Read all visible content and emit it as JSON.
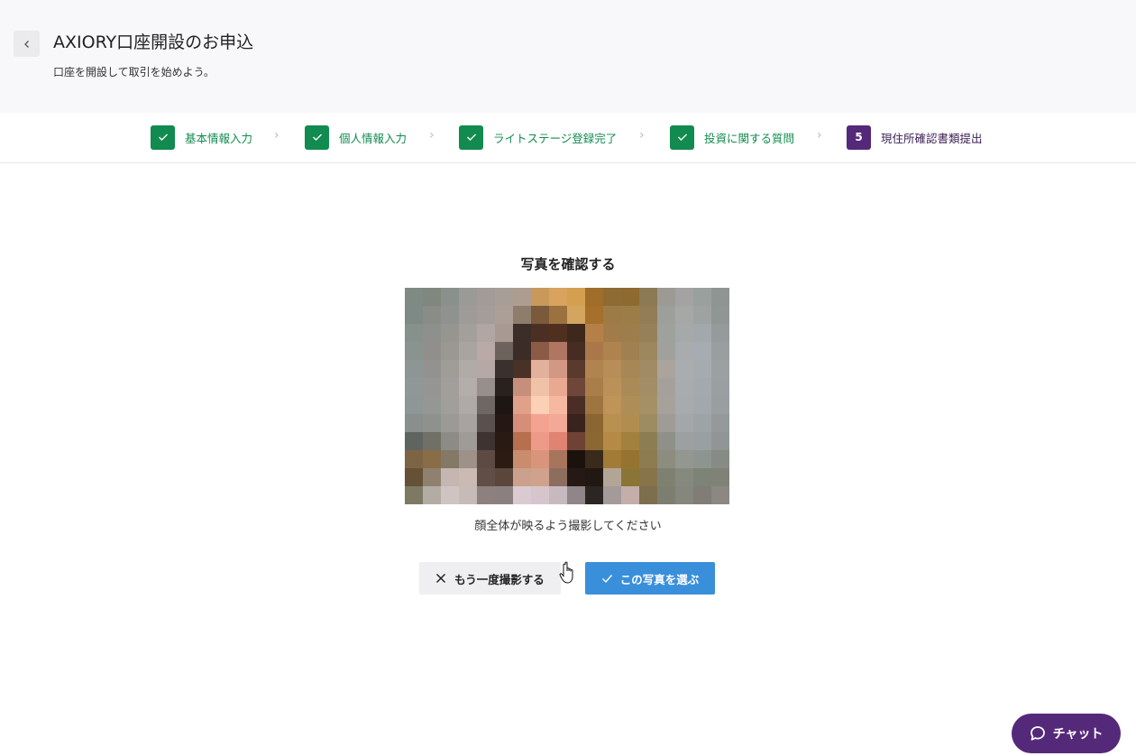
{
  "header": {
    "back_icon": "chevron-left-icon",
    "title": "AXIORY口座開設のお申込",
    "subtitle": "口座を開設して取引を始めよう。"
  },
  "stepper": {
    "steps": [
      {
        "label": "基本情報入力",
        "status": "done",
        "badge": "✓"
      },
      {
        "label": "個人情報入力",
        "status": "done",
        "badge": "✓"
      },
      {
        "label": "ライトステージ登録完了",
        "status": "done",
        "badge": "✓"
      },
      {
        "label": "投資に関する質問",
        "status": "done",
        "badge": "✓"
      },
      {
        "label": "現住所確認書類提出",
        "status": "current",
        "badge": "5"
      }
    ],
    "separator": "›"
  },
  "confirm": {
    "title": "写真を確認する",
    "hint": "顔全体が映るよう撮影してください"
  },
  "actions": {
    "retake_label": "もう一度撮影する",
    "retake_icon": "close-icon",
    "choose_label": "この写真を選ぶ",
    "choose_icon": "check-icon"
  },
  "chat": {
    "label": "チャット",
    "icon": "chat-bubble-icon"
  },
  "colors": {
    "done_green": "#118b4f",
    "current_purple": "#55297a",
    "primary_blue": "#3a8fdb"
  }
}
